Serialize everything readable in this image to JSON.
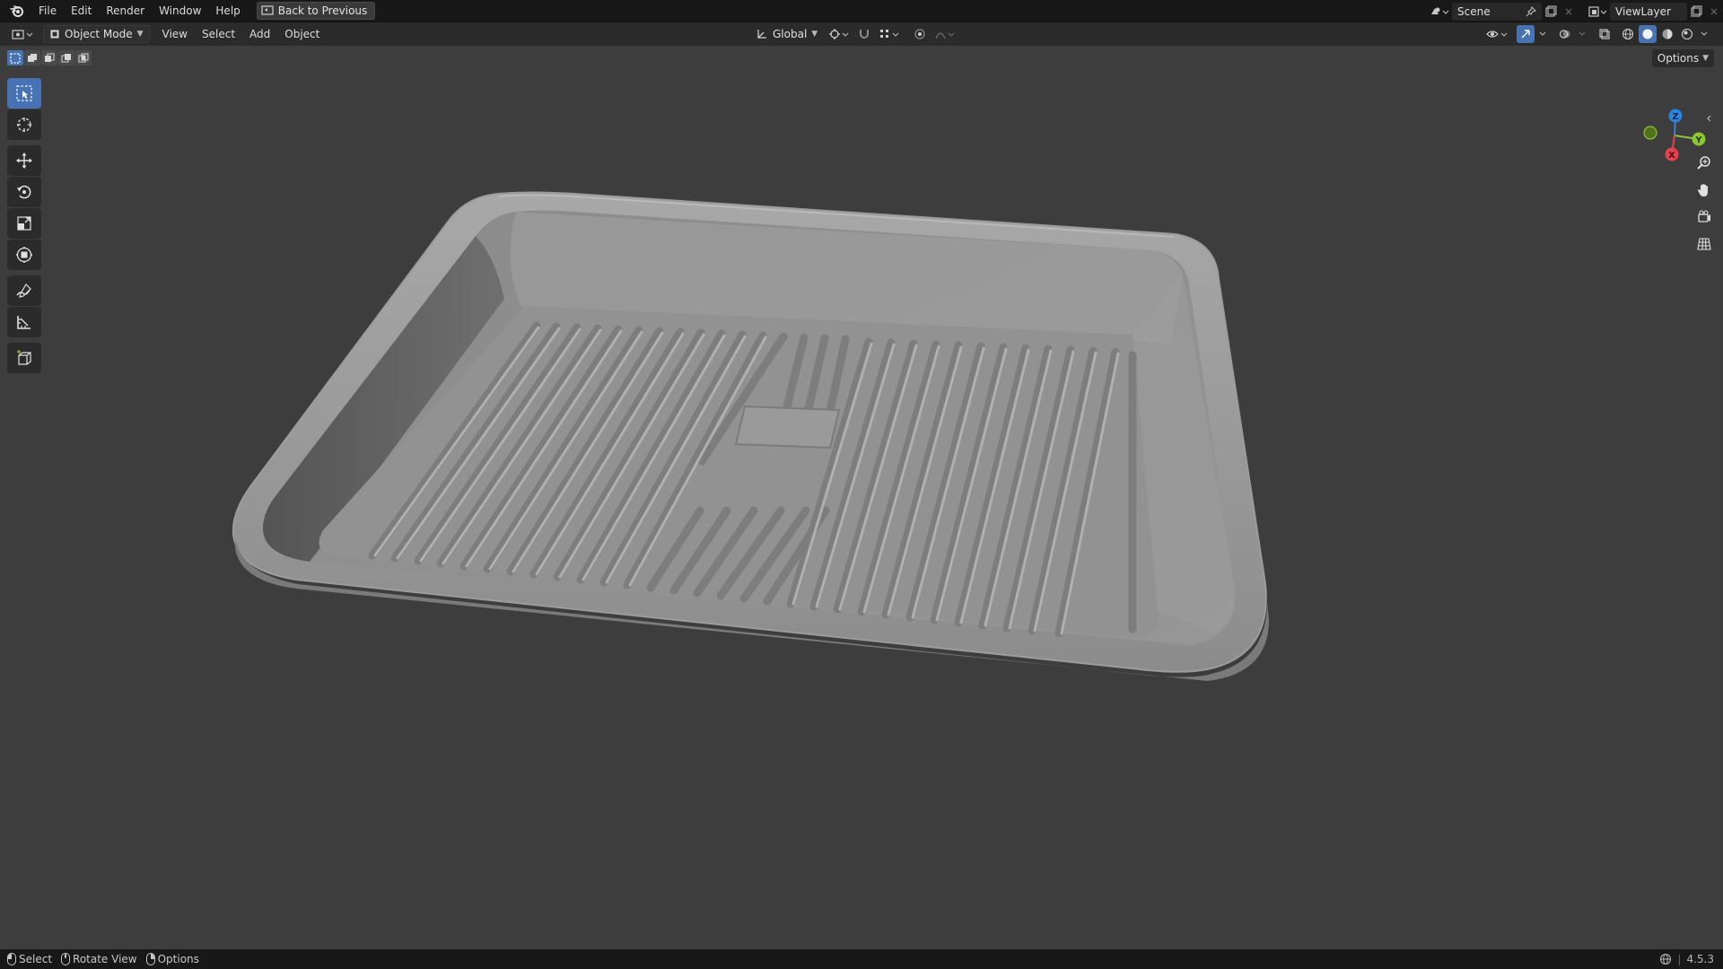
{
  "menu": {
    "items": [
      "File",
      "Edit",
      "Render",
      "Window",
      "Help"
    ],
    "back_label": "Back to Previous"
  },
  "top_right": {
    "scene": "Scene",
    "view_layer": "ViewLayer"
  },
  "header": {
    "mode": "Object Mode",
    "menus": [
      "View",
      "Select",
      "Add",
      "Object"
    ],
    "orientation": "Global"
  },
  "viewport": {
    "options_label": "Options",
    "gizmo_axes": [
      "Z",
      "Y",
      "X"
    ]
  },
  "status": {
    "hints": [
      "Select",
      "Rotate View",
      "Options"
    ],
    "version": "4.5.3"
  },
  "colors": {
    "accent": "#4772b3",
    "axis_x": "#e8414e",
    "axis_y": "#8bc635",
    "axis_z": "#2f83e0"
  }
}
